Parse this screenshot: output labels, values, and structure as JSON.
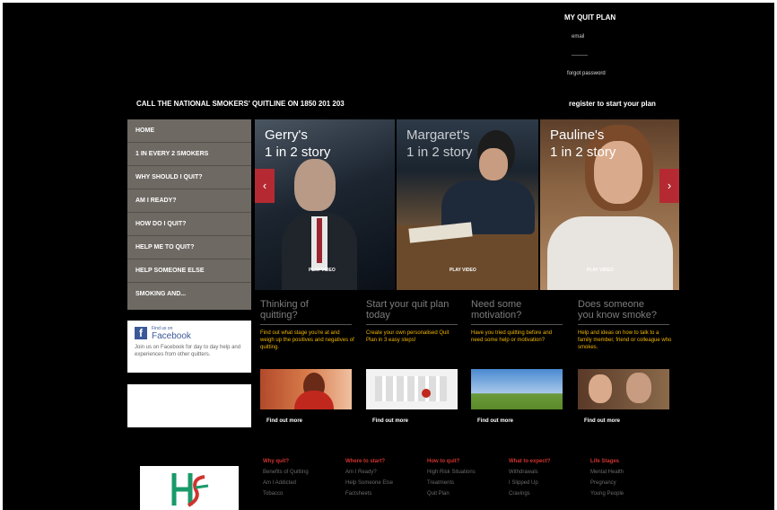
{
  "header": {
    "quit_plan_title": "MY QUIT PLAN",
    "email_label": "email",
    "password_label": "———",
    "forgot_password": "forgot password",
    "quitline": "CALL THE NATIONAL SMOKERS' QUITLINE ON 1850 201 203",
    "register": "register to start your plan"
  },
  "nav": {
    "items": [
      "HOME",
      "1 IN EVERY 2 SMOKERS",
      "WHY SHOULD I QUIT?",
      "AM I READY?",
      "HOW DO I QUIT?",
      "HELP ME TO QUIT?",
      "HELP SOMEONE ELSE",
      "SMOKING AND..."
    ]
  },
  "facebook": {
    "small": "Find us on",
    "name": "Facebook",
    "text": "Join us on Facebook for day to day help and experiences from other quitters."
  },
  "hero": {
    "stories": [
      {
        "name": "Gerry's",
        "sub": "1 in 2 story",
        "play": "PLAY VIDEO"
      },
      {
        "name": "Margaret's",
        "sub": "1 in 2 story",
        "play": "PLAY VIDEO"
      },
      {
        "name": "Pauline's",
        "sub": "1 in 2 story",
        "play": "PLAY VIDEO"
      }
    ],
    "prev": "‹",
    "next": "›"
  },
  "features": [
    {
      "title1": "Thinking of",
      "title2": "quitting?",
      "desc": "Find out what stage you're at and weigh up the positives and negatives of quitting.",
      "link": "Find out more"
    },
    {
      "title1": "Start your quit plan",
      "title2": "today",
      "desc": "Create your own personalised Quit Plan in 3 easy steps!",
      "link": "Find out more"
    },
    {
      "title1": "Need some",
      "title2": "motivation?",
      "desc": "Have you tried quitting before and need some help or motivation?",
      "link": "Find out more"
    },
    {
      "title1": "Does someone",
      "title2": "you know smoke?",
      "desc": "Help and ideas on how to talk to a family member, friend or colleague who smokes.",
      "link": "Find out more"
    }
  ],
  "footer": {
    "columns": [
      {
        "head": "Why quit?",
        "links": [
          "Benefits of Quitting",
          "Am I Addicted",
          "Tobacco"
        ]
      },
      {
        "head": "Where to start?",
        "links": [
          "Am I Ready?",
          "Help Someone Else",
          "Factsheets"
        ]
      },
      {
        "head": "How to quit?",
        "links": [
          "High Risk Situations",
          "Treatments",
          "Quit Plan"
        ]
      },
      {
        "head": "What to expect?",
        "links": [
          "Withdrawals",
          "I Slipped Up",
          "Cravings"
        ]
      },
      {
        "head": "Life Stages",
        "links": [
          "Mental Health",
          "Pregnancy",
          "Young People"
        ]
      }
    ]
  },
  "colors": {
    "accent_red": "#b52a32",
    "feature_yellow": "#f0b400",
    "nav_grey": "#6e6963"
  }
}
